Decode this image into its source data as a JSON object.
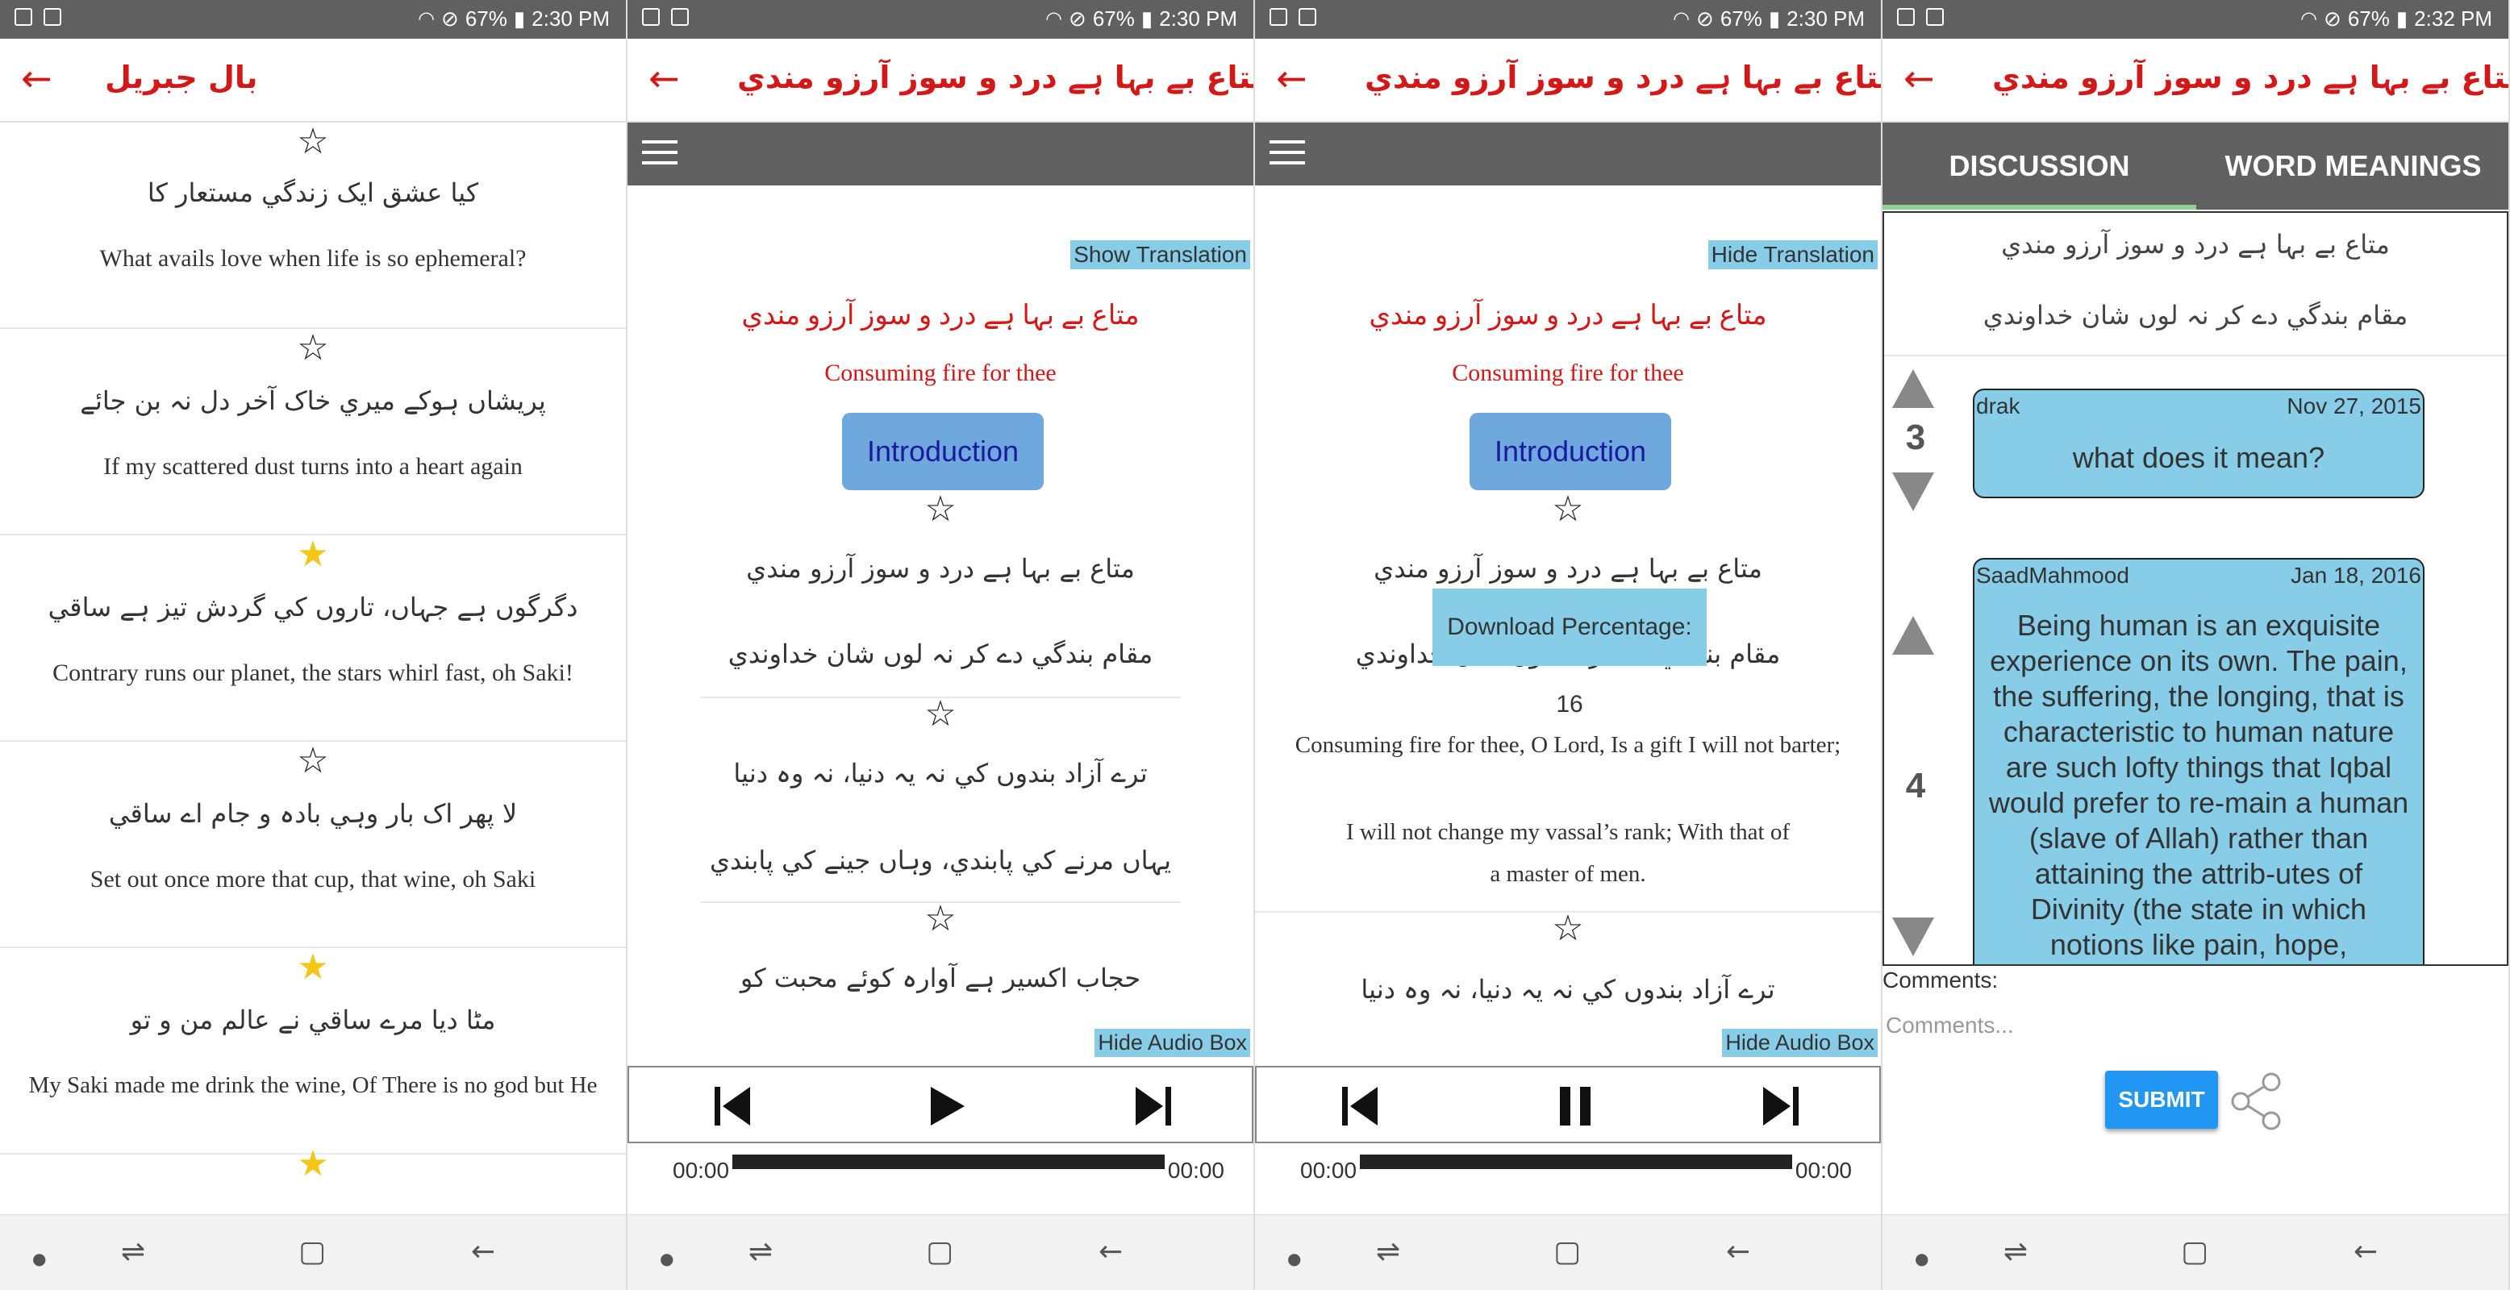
{
  "status_bars": [
    {
      "battery": "67%",
      "time": "2:30 PM"
    },
    {
      "battery": "67%",
      "time": "2:30 PM"
    },
    {
      "battery": "67%",
      "time": "2:30 PM"
    },
    {
      "battery": "67%",
      "time": "2:32 PM"
    }
  ],
  "colors": {
    "accent_red": "#d41818",
    "toolbar_gray": "#616161",
    "highlight_blue": "#87cde8",
    "button_blue": "#6fa8dc",
    "submit_blue": "#2196f3",
    "star_gold": "#f5c518"
  },
  "screen1": {
    "title": "بال جبريل",
    "verses": [
      {
        "urdu": "کيا عشق ايک زندگي مستعار کا",
        "english": "What avails love when life is so ephemeral?",
        "starred": false
      },
      {
        "urdu": "پريشاں ہوکے ميري خاک آخر دل نہ بن جائے",
        "english": "If my scattered dust turns into a heart again",
        "starred": false
      },
      {
        "urdu": "دگرگوں ہے جہاں، تاروں کي گردش تيز ہے ساقي",
        "english": "Contrary runs our planet, the stars whirl fast, oh Saki!",
        "starred": true
      },
      {
        "urdu": "لا پھر اک بار وہي بادہ و جام اے ساقي",
        "english": "Set out once more that cup, that wine, oh Saki",
        "starred": false
      },
      {
        "urdu": "مٹا ديا مرے ساقي نے عالم من و تو",
        "english": "My Saki made me drink the wine, Of There is no god but He",
        "starred": true
      }
    ]
  },
  "screen2": {
    "title": "متاع بے بہا ہے درد و سوز آرزو مندي",
    "toggle_translation": "Show Translation",
    "poem_title_urdu": "متاع بے بہا ہے درد و سوز آرزو مندي",
    "poem_title_english": "Consuming fire for thee",
    "intro_button": "Introduction",
    "couplets": [
      {
        "line1": "متاع بے بہا ہے درد و سوز آرزو مندي",
        "line2": "مقام بندگي دے کر نہ لوں شان خداوندي"
      },
      {
        "line1": "ترے آزاد بندوں کي نہ يہ دنيا، نہ وہ دنيا",
        "line2": "يہاں مرنے کي پابندي، وہاں جينے کي پابندي"
      },
      {
        "line1": "حجاب اکسير ہے آوارہ کوئے محبت کو",
        "line2": ""
      }
    ],
    "hide_audio": "Hide Audio Box",
    "time_start": "00:00",
    "time_end": "00:00"
  },
  "screen3": {
    "title": "متاع بے بہا ہے درد و سوز آرزو مندي",
    "toggle_translation": "Hide Translation",
    "poem_title_urdu": "متاع بے بہا ہے درد و سوز آرزو مندي",
    "poem_title_english": "Consuming fire for thee",
    "intro_button": "Introduction",
    "couplet1_line1": "متاع بے بہا ہے درد و سوز آرزو مندي",
    "couplet1_line2": "مقام بندگي دے کر نہ لوں شان خداوندي",
    "download_toast": "Download Percentage: 16",
    "translation_line1": "Consuming fire for thee, O Lord, Is a gift I will not barter;",
    "translation_line2a": "I will not change my vassal’s rank; With that of",
    "translation_line2b": "a master of men.",
    "couplet2_line1": "ترے آزاد بندوں کي نہ يہ دنيا، نہ وہ دنيا",
    "hide_audio": "Hide Audio Box",
    "time_start": "00:00",
    "time_end": "00:00"
  },
  "screen4": {
    "title": "متاع بے بہا ہے درد و سوز آرزو مندي",
    "tabs": [
      "DISCUSSION",
      "WORD MEANINGS"
    ],
    "couplet_line1": "متاع بے بہا ہے درد و سوز آرزو مندي",
    "couplet_line2": "مقام بندگي دے کر نہ لوں شان خداوندي",
    "comments": [
      {
        "user": "drak",
        "date": "Nov 27, 2015",
        "votes": "3",
        "text": "what does it mean?"
      },
      {
        "user": "SaadMahmood",
        "date": "Jan 18, 2016",
        "votes": "4",
        "text": "Being human is an exquisite experience on its own. The pain, the suffering, the longing, that is characteristic to human nature are such lofty things that Iqbal would prefer to re-main a human (slave of Allah) rather than attaining the attrib-utes of Divinity (the state in which notions like pain, hope,"
      }
    ],
    "comments_label": "Comments:",
    "comments_placeholder": "Comments...",
    "submit": "SUBMIT"
  }
}
